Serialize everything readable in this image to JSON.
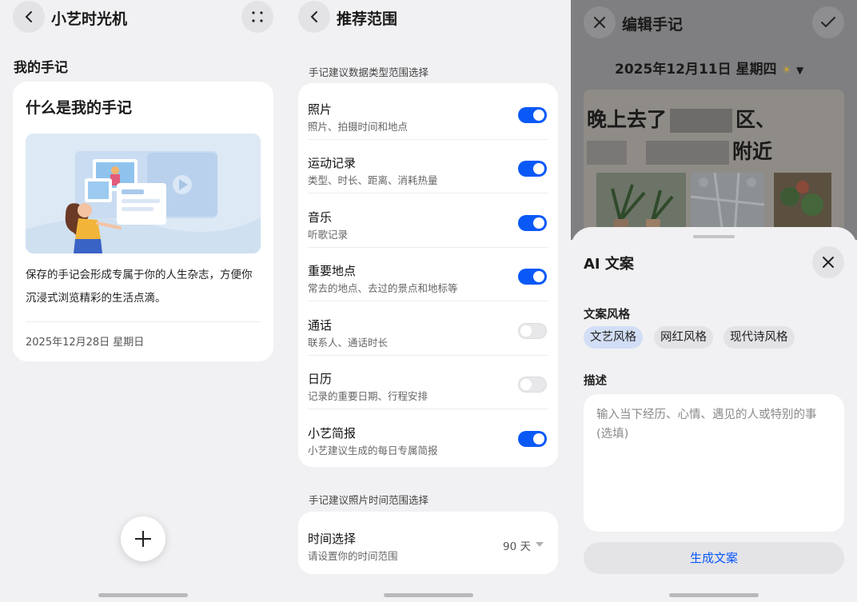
{
  "panel1": {
    "title": "小艺时光机",
    "section_title": "我的手记",
    "card": {
      "heading": "什么是我的手记",
      "description": "保存的手记会形成专属于你的人生杂志，方便你沉浸式浏览精彩的生活点滴。",
      "date": "2025年12月28日 星期日"
    },
    "fab_icon": "plus-icon"
  },
  "panel2": {
    "title": "推荐范围",
    "section1_label": "手记建议数据类型范围选择",
    "items": [
      {
        "title": "照片",
        "subtitle": "照片、拍摄时间和地点",
        "enabled": true
      },
      {
        "title": "运动记录",
        "subtitle": "类型、时长、距离、消耗热量",
        "enabled": true
      },
      {
        "title": "音乐",
        "subtitle": "听歌记录",
        "enabled": true
      },
      {
        "title": "重要地点",
        "subtitle": "常去的地点、去过的景点和地标等",
        "enabled": true
      },
      {
        "title": "通话",
        "subtitle": "联系人、通话时长",
        "enabled": false
      },
      {
        "title": "日历",
        "subtitle": "记录的重要日期、行程安排",
        "enabled": false
      },
      {
        "title": "小艺简报",
        "subtitle": "小艺建议生成的每日专属简报",
        "enabled": true
      }
    ],
    "section2_label": "手记建议照片时间范围选择",
    "time_select": {
      "title": "时间选择",
      "subtitle": "请设置你的时间范围",
      "value": "90 天"
    }
  },
  "panel3": {
    "title": "编辑手记",
    "date_line": "2025年12月11日 星期四",
    "note_line1": "晚上去了",
    "note_line1_end": "区、",
    "note_line2_end": "附近",
    "sheet": {
      "title": "AI 文案",
      "style_label": "文案风格",
      "styles": [
        "文艺风格",
        "网红风格",
        "现代诗风格"
      ],
      "selected_style": "文艺风格",
      "desc_label": "描述",
      "desc_placeholder": "输入当下经历、心情、遇见的人或特别的事 (选填)",
      "generate_label": "生成文案"
    }
  },
  "colors": {
    "accent": "#0a59f7",
    "background": "#f1f1f3",
    "card": "#ffffff"
  }
}
